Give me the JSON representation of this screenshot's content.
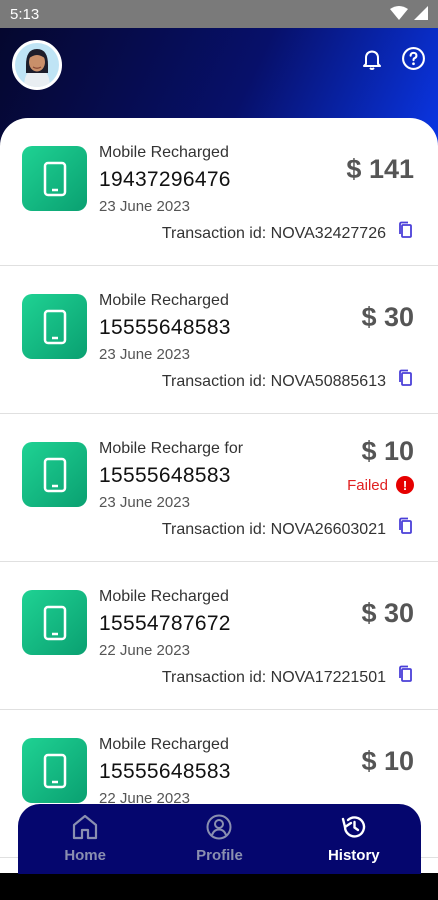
{
  "status_bar": {
    "time": "5:13"
  },
  "transactions": [
    {
      "title": "Mobile Recharged",
      "number": "19437296476",
      "date": "23 June 2023",
      "amount": "$ 141",
      "txn_label": "Transaction id: NOVA32427726"
    },
    {
      "title": "Mobile Recharged",
      "number": "15555648583",
      "date": "23 June 2023",
      "amount": "$ 30",
      "txn_label": "Transaction id: NOVA50885613"
    },
    {
      "title": "Mobile Recharge for",
      "number": "15555648583",
      "date": "23 June 2023",
      "amount": "$ 10",
      "status": "Failed",
      "txn_label": "Transaction id: NOVA26603021"
    },
    {
      "title": "Mobile Recharged",
      "number": "15554787672",
      "date": "22 June 2023",
      "amount": "$ 30",
      "txn_label": "Transaction id: NOVA17221501"
    },
    {
      "title": "Mobile Recharged",
      "number": "15555648583",
      "date": "22 June 2023",
      "amount": "$ 10",
      "txn_label": ""
    }
  ],
  "nav": {
    "home": "Home",
    "profile": "Profile",
    "history": "History",
    "active": "history"
  },
  "colors": {
    "accent_green": "#1fd293",
    "nav_background": "#05066e",
    "failed_red": "#e02020",
    "copy_icon": "#4a3fd8"
  }
}
